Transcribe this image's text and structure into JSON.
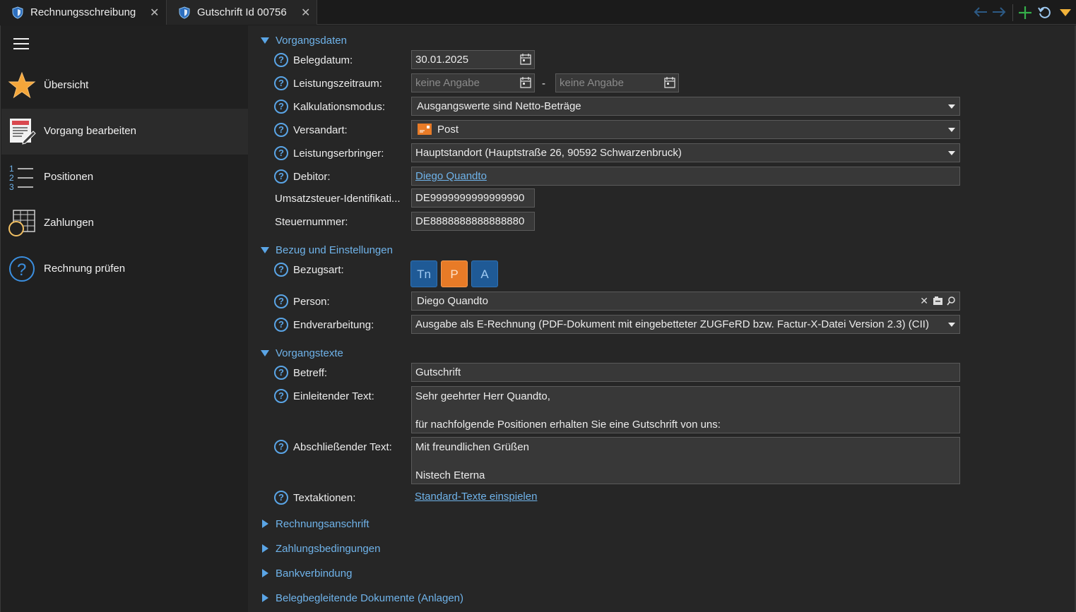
{
  "tabs": [
    {
      "label": "Rechnungsschreibung"
    },
    {
      "label": "Gutschrift Id 00756"
    }
  ],
  "sidebar": {
    "items": [
      {
        "label": "Übersicht"
      },
      {
        "label": "Vorgang bearbeiten"
      },
      {
        "label": "Positionen"
      },
      {
        "label": "Zahlungen"
      },
      {
        "label": "Rechnung prüfen"
      }
    ]
  },
  "sections": {
    "vorgangsdaten": "Vorgangsdaten",
    "bezug": "Bezug und Einstellungen",
    "vorgangstexte": "Vorgangstexte",
    "rechnungsanschrift": "Rechnungsanschrift",
    "zahlungsbedingungen": "Zahlungsbedingungen",
    "bankverbindung": "Bankverbindung",
    "anlagen": "Belegbegleitende Dokumente (Anlagen)"
  },
  "fields": {
    "belegdatum": {
      "label": "Belegdatum:",
      "value": "30.01.2025"
    },
    "leistungszeitraum": {
      "label": "Leistungszeitraum:",
      "from": "keine Angabe",
      "separator": "-",
      "to": "keine Angabe"
    },
    "kalkulationsmodus": {
      "label": "Kalkulationsmodus:",
      "value": "Ausgangswerte sind Netto-Beträge"
    },
    "versandart": {
      "label": "Versandart:",
      "value": "Post"
    },
    "leistungserbringer": {
      "label": "Leistungserbringer:",
      "value": "Hauptstandort (Hauptstraße 26, 90592 Schwarzenbruck)"
    },
    "debitor": {
      "label": "Debitor:",
      "value": "Diego Quandto"
    },
    "ustid": {
      "label": "Umsatzsteuer-Identifikati...",
      "value": "DE9999999999999990"
    },
    "steuernummer": {
      "label": "Steuernummer:",
      "value": "DE8888888888888880"
    },
    "bezugsart": {
      "label": "Bezugsart:",
      "buttons": [
        "Tn",
        "P",
        "A"
      ]
    },
    "person": {
      "label": "Person:",
      "value": "Diego Quandto"
    },
    "endverarbeitung": {
      "label": "Endverarbeitung:",
      "value": "Ausgabe als E-Rechnung (PDF-Dokument mit eingebetteter ZUGFeRD bzw. Factur-X-Datei Version 2.3) (CII)"
    },
    "betreff": {
      "label": "Betreff:",
      "value": "Gutschrift"
    },
    "einleitender_text": {
      "label": "Einleitender Text:",
      "line1": "Sehr geehrter Herr Quandto,",
      "line2": "für nachfolgende Positionen erhalten Sie eine Gutschrift von uns:"
    },
    "abschliessender_text": {
      "label": "Abschließender Text:",
      "line1": "Mit freundlichen Grüßen",
      "line2": "Nistech Eterna"
    },
    "textaktionen": {
      "label": "Textaktionen:",
      "link": "Standard-Texte einspielen"
    }
  },
  "colors": {
    "accent": "#6fb3ea",
    "button_blue": "#1f5a96",
    "button_orange": "#e87b27"
  }
}
